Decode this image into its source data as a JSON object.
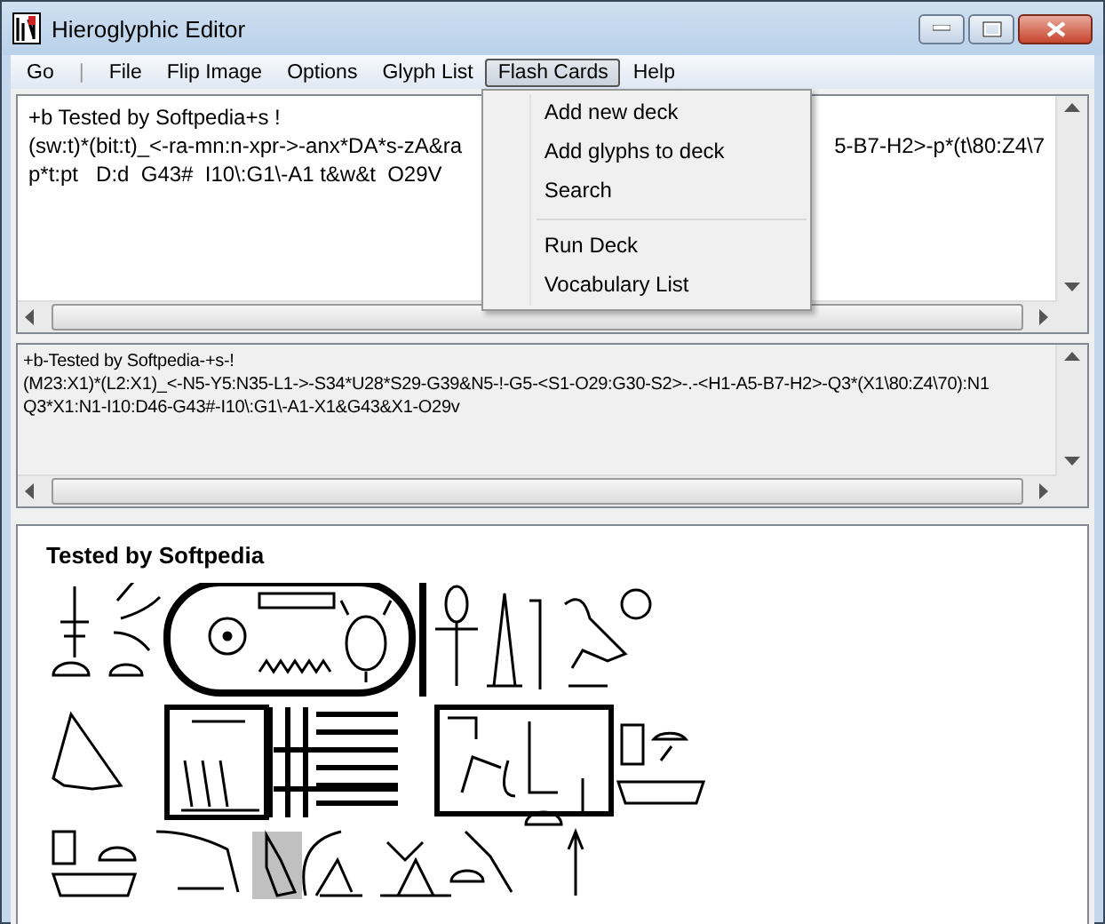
{
  "window": {
    "title": "Hieroglyphic Editor"
  },
  "menu": [
    {
      "label": "Go",
      "kind": "item",
      "selected": false
    },
    {
      "label": "|",
      "kind": "separator"
    },
    {
      "label": "File",
      "kind": "item",
      "selected": false
    },
    {
      "label": "Flip Image",
      "kind": "item",
      "selected": false
    },
    {
      "label": "Options",
      "kind": "item",
      "selected": false
    },
    {
      "label": "Glyph List",
      "kind": "item",
      "selected": false
    },
    {
      "label": "Flash Cards",
      "kind": "item",
      "selected": true
    },
    {
      "label": "Help",
      "kind": "item",
      "selected": false
    }
  ],
  "dropdown": [
    {
      "label": "Add new deck",
      "kind": "item"
    },
    {
      "label": "Add glyphs to deck",
      "kind": "item"
    },
    {
      "label": "Search",
      "kind": "item"
    },
    {
      "kind": "separator"
    },
    {
      "label": "Run Deck",
      "kind": "item"
    },
    {
      "label": "Vocabulary List",
      "kind": "item"
    }
  ],
  "editor": {
    "lines": [
      [
        "+b Tested by Softpedia+s !"
      ],
      [
        "(sw:t)*(bit:t)_<-ra-mn:n-xpr->-anx*DA*s-zA&ra",
        "5-B7-H2>-p*(t\\80:Z4\\7"
      ],
      [
        "p*t:pt   D:d  G43#  I10\\:G1\\-A1 t&w&t  O29V"
      ]
    ]
  },
  "code_view": {
    "lines": [
      "+b-Tested by Softpedia-+s-!",
      "(M23:X1)*(L2:X1)_<-N5-Y5:N35-L1->-S34*U28*S29-G39&N5-!-G5-<S1-O29:G30-S2>-.-<H1-A5-B7-H2>-Q3*(X1\\80:Z4\\70):N1",
      "Q3*X1:N1-I10:D46-G43#-I10\\:G1\\-A1-X1&G43&X1-O29v"
    ]
  },
  "preview": {
    "heading": "Tested by Softpedia"
  }
}
